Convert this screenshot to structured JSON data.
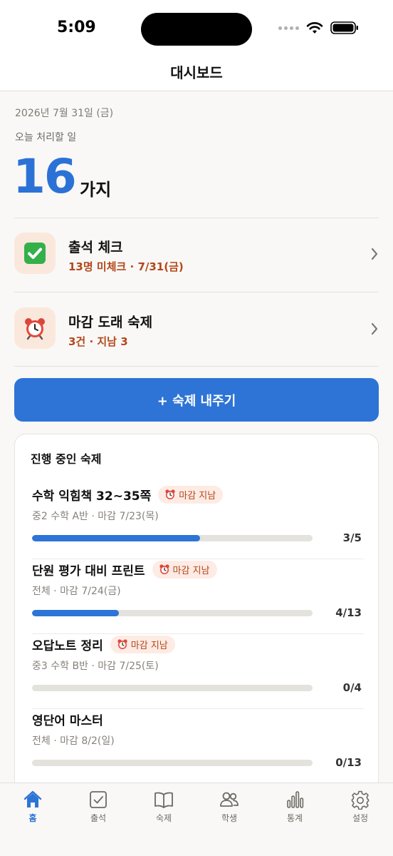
{
  "status_bar": {
    "time": "5:09",
    "icons": [
      "signal-dots-icon",
      "wifi-icon",
      "battery-icon"
    ]
  },
  "nav": {
    "title": "대시보드"
  },
  "summary": {
    "date": "2026년 7월 31일 (금)",
    "label": "오늘 처리할 일",
    "count": "16",
    "unit": "가지"
  },
  "tasks": [
    {
      "icon": "check-mark-icon",
      "title": "출석 체크",
      "subtitle": "13명 미체크 · 7/31(금)"
    },
    {
      "icon": "alarm-clock-icon",
      "title": "마감 도래 숙제",
      "subtitle": "3건 · 지남 3"
    }
  ],
  "primary_button": {
    "label": "+ 숙제 내주기"
  },
  "homework_card": {
    "title": "진행 중인 숙제",
    "overdue_label": "마감 지남",
    "items": [
      {
        "title": "수학 익힘책 32~35쪽",
        "meta": "중2 수학 A반 · 마감 7/23(목)",
        "count": "3/5",
        "progress": 0.6,
        "overdue": true
      },
      {
        "title": "단원 평가 대비 프린트",
        "meta": "전체 · 마감 7/24(금)",
        "count": "4/13",
        "progress": 0.31,
        "overdue": true
      },
      {
        "title": "오답노트 정리",
        "meta": "중3 수학 B반 · 마감 7/25(토)",
        "count": "0/4",
        "progress": 0,
        "overdue": true
      },
      {
        "title": "영단어 마스터",
        "meta": "전체 · 마감 8/2(일)",
        "count": "0/13",
        "progress": 0,
        "overdue": false
      }
    ]
  },
  "tab_bar": {
    "tabs": [
      {
        "label": "홈",
        "icon": "home-icon",
        "active": true
      },
      {
        "label": "출석",
        "icon": "checkbox-icon",
        "active": false
      },
      {
        "label": "숙제",
        "icon": "book-icon",
        "active": false
      },
      {
        "label": "학생",
        "icon": "people-icon",
        "active": false
      },
      {
        "label": "통계",
        "icon": "bar-chart-icon",
        "active": false
      },
      {
        "label": "설정",
        "icon": "gear-icon",
        "active": false
      }
    ]
  },
  "colors": {
    "accent": "#2d74d6",
    "warning_text": "#b3471b",
    "warning_bg": "#fdebe4"
  }
}
